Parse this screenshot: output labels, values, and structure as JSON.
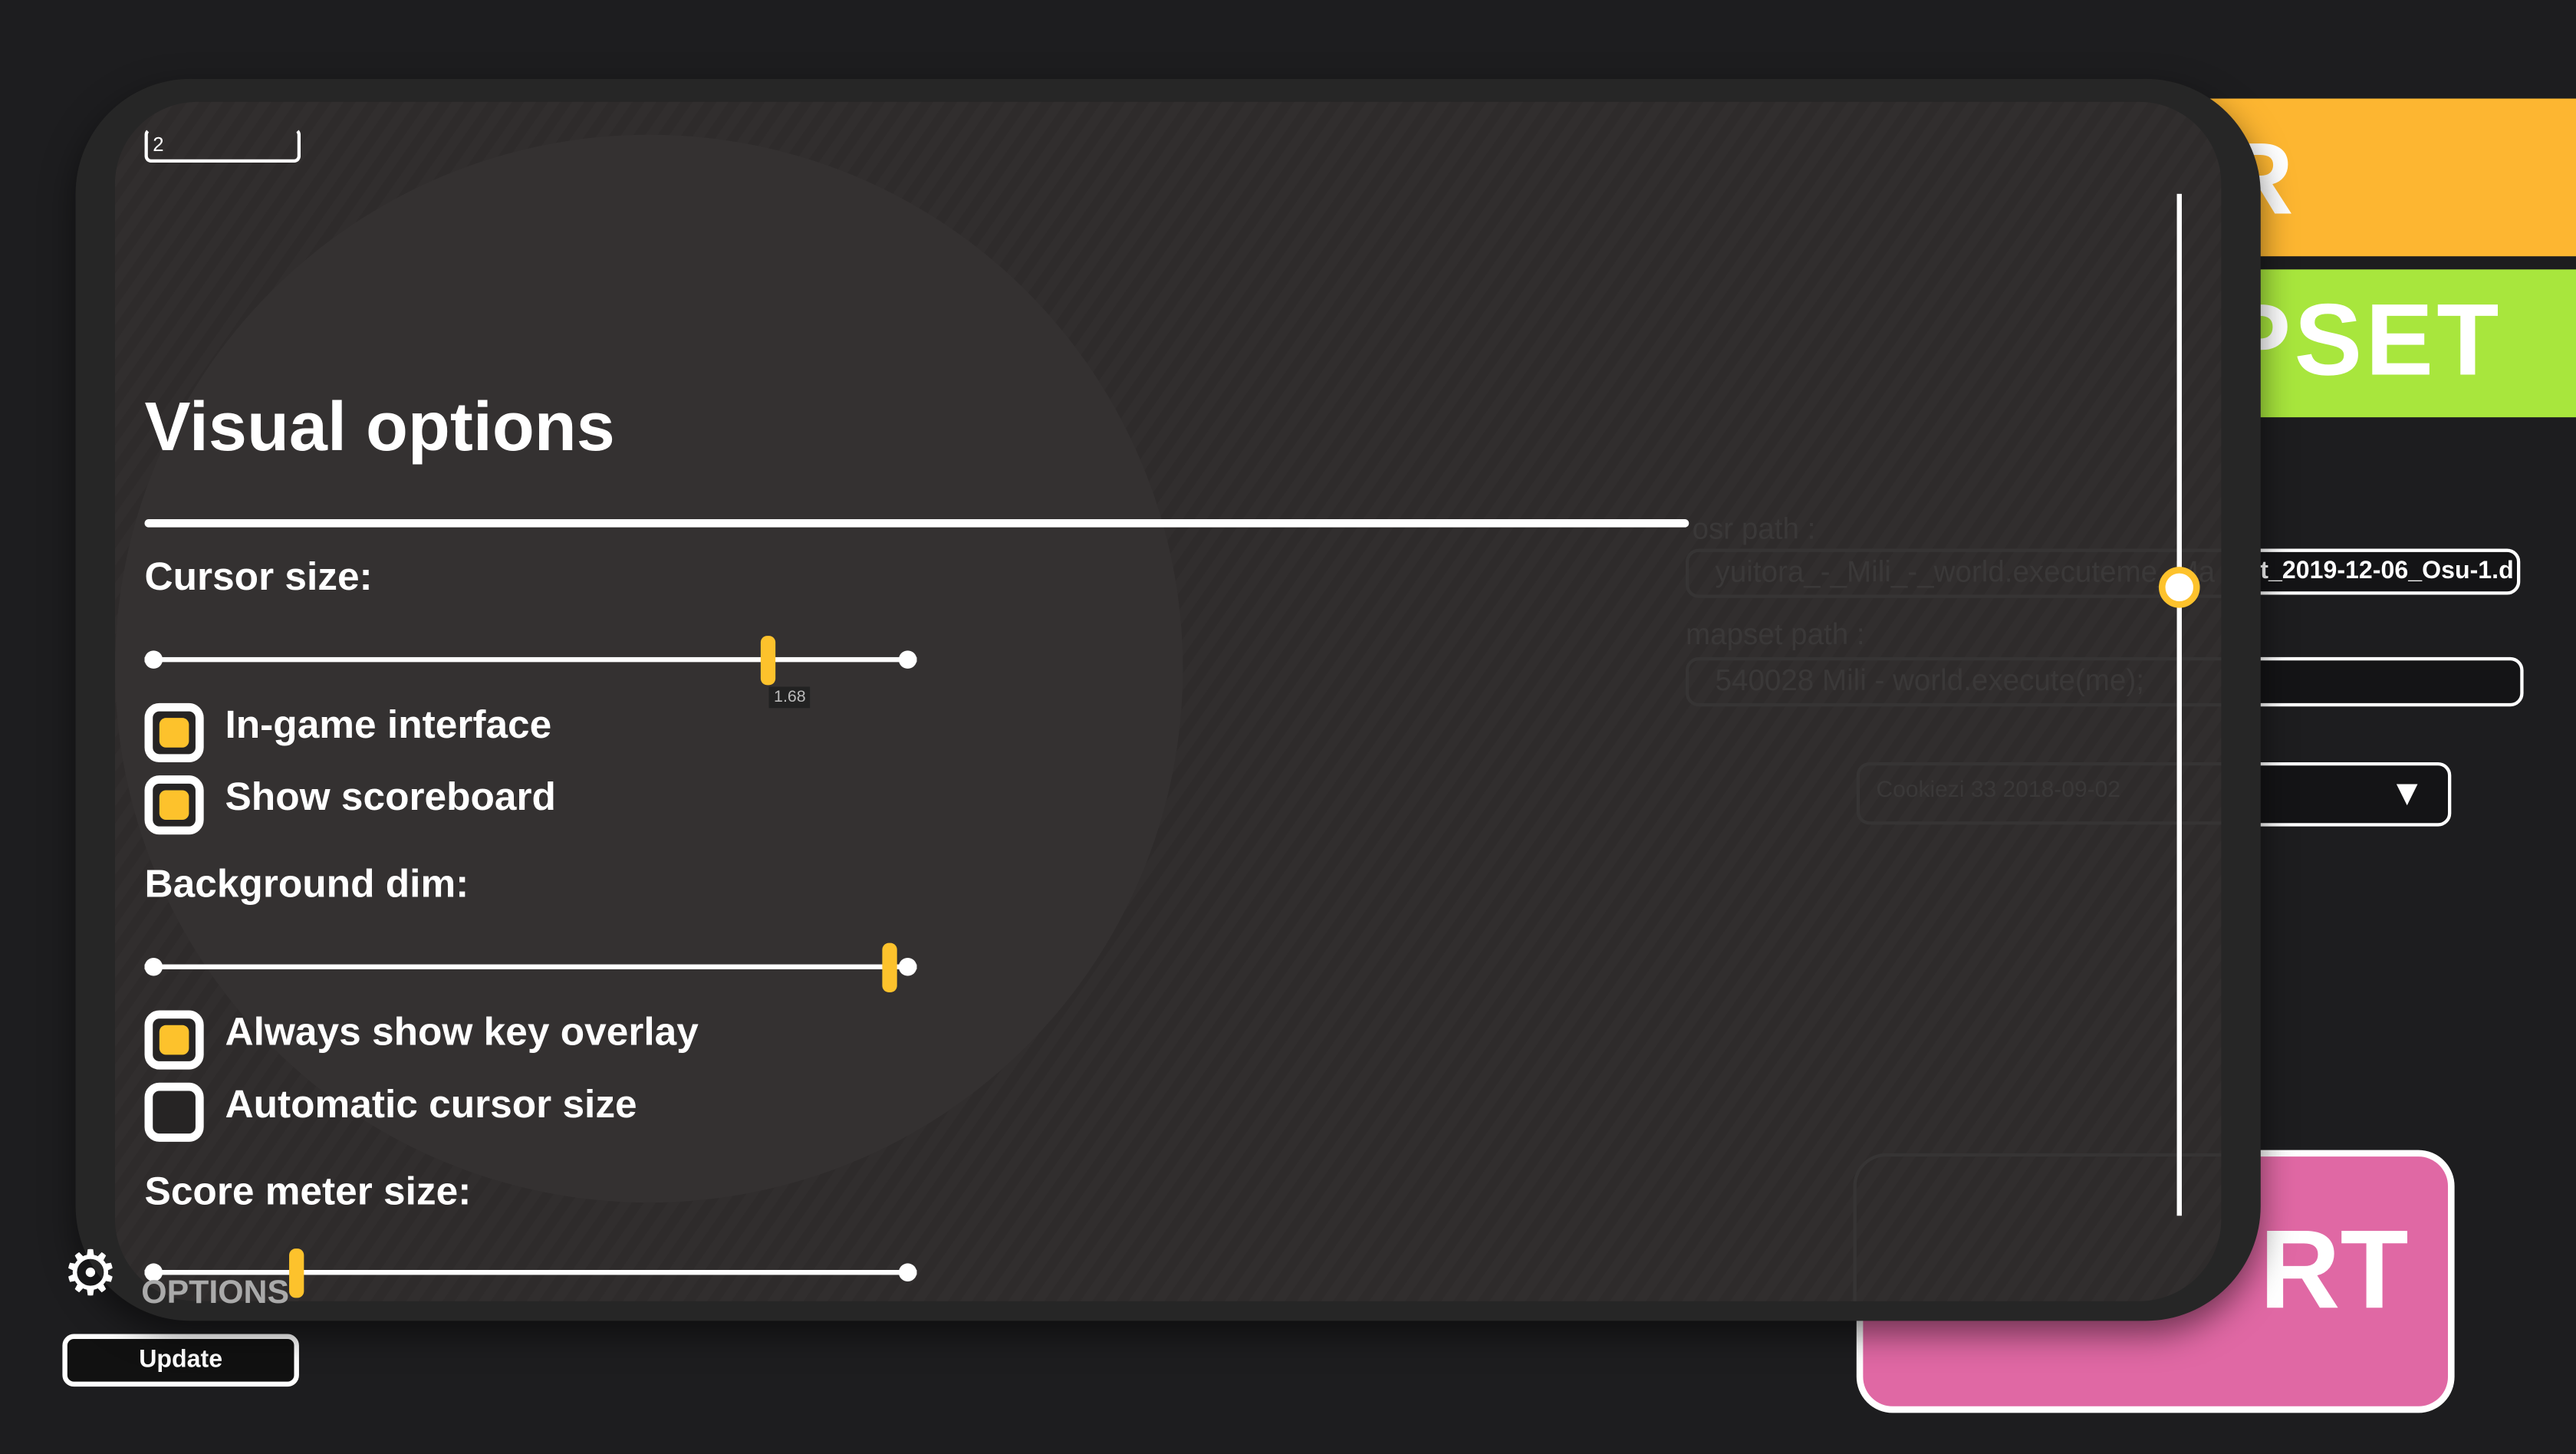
{
  "background": {
    "render_button_label": "R",
    "mapset_button_label": "PSET",
    "osr_path_label": "osr path :",
    "osr_path_value": "yuitora_-_Mili_-_world.executeme_Ma",
    "osr_path_value_visible": "t_2019-12-06_Osu-1.d",
    "mapset_path_label": "mapset path :",
    "mapset_path_value": "540028 Mili - world.execute(me);",
    "replay_select_value": "Cookiezi 33 2018-09-02",
    "start_button_label": "RT",
    "options_label": "OPTIONS",
    "update_button_label": "Update"
  },
  "visual_options": {
    "tab_input_value": "2",
    "title": "Visual options",
    "cursor_size": {
      "label": "Cursor size:",
      "value": "1.68",
      "fraction": 0.817
    },
    "checkboxes1": [
      {
        "label": "In-game interface",
        "checked": true
      },
      {
        "label": "Show scoreboard",
        "checked": true
      }
    ],
    "background_dim": {
      "label": "Background dim:",
      "fraction": 0.978
    },
    "checkboxes2": [
      {
        "label": "Always show key overlay",
        "checked": true
      },
      {
        "label": "Automatic cursor size",
        "checked": false
      }
    ],
    "score_meter_size": {
      "label": "Score meter size:",
      "fraction": 0.19
    },
    "scrollbar_position": 0.385
  },
  "colors": {
    "accent": "#fdc22c",
    "render": "#fdb631",
    "mapset": "#a8e63d",
    "start": "#e068a4",
    "panel": "#2f2c2c"
  }
}
